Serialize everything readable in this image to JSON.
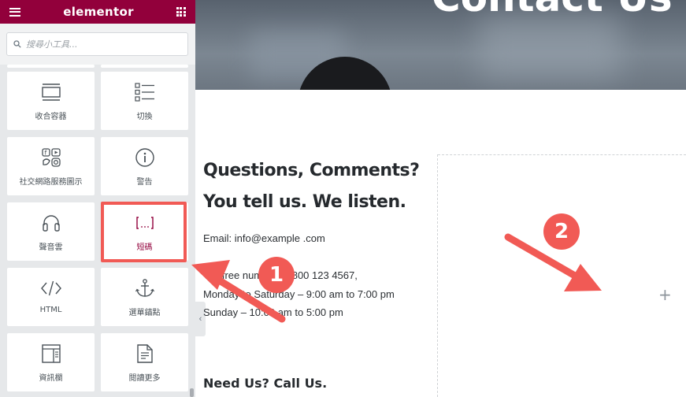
{
  "topbar": {
    "brand": "elementor",
    "menu_icon": "hamburger-menu-icon",
    "apps_icon": "grid-apps-icon",
    "color": "#92003b"
  },
  "search": {
    "placeholder": "搜尋小工具..."
  },
  "widgets": [
    {
      "label": "收合容器",
      "icon": "accordion-icon"
    },
    {
      "label": "切換",
      "icon": "toggle-icon"
    },
    {
      "label": "社交網路服務圖示",
      "icon": "social-icons-icon"
    },
    {
      "label": "警告",
      "icon": "alert-icon"
    },
    {
      "label": "聲音雲",
      "icon": "soundcloud-headphones-icon"
    },
    {
      "label": "短碼",
      "icon": "shortcode-icon",
      "highlighted": true
    },
    {
      "label": "HTML",
      "icon": "html-code-icon"
    },
    {
      "label": "選單錨點",
      "icon": "anchor-icon"
    },
    {
      "label": "資訊欄",
      "icon": "sidebar-icon"
    },
    {
      "label": "閱讀更多",
      "icon": "read-more-icon"
    }
  ],
  "page": {
    "hero_title": "Contact Us",
    "heading_line1": "Questions, Comments?",
    "heading_line2": "You tell us. We listen.",
    "email": "Email: info@example .com",
    "line_tollfree": "Toll-free number: 1-800 123 4567,",
    "line_weekday": "Monday to Saturday – 9:00 am to 7:00 pm",
    "line_sunday": "Sunday – 10:00 am to 5:00 pm",
    "call_heading": "Need Us? Call Us."
  },
  "annotations": {
    "badge1": "1",
    "badge2": "2",
    "color": "#f15a55"
  }
}
